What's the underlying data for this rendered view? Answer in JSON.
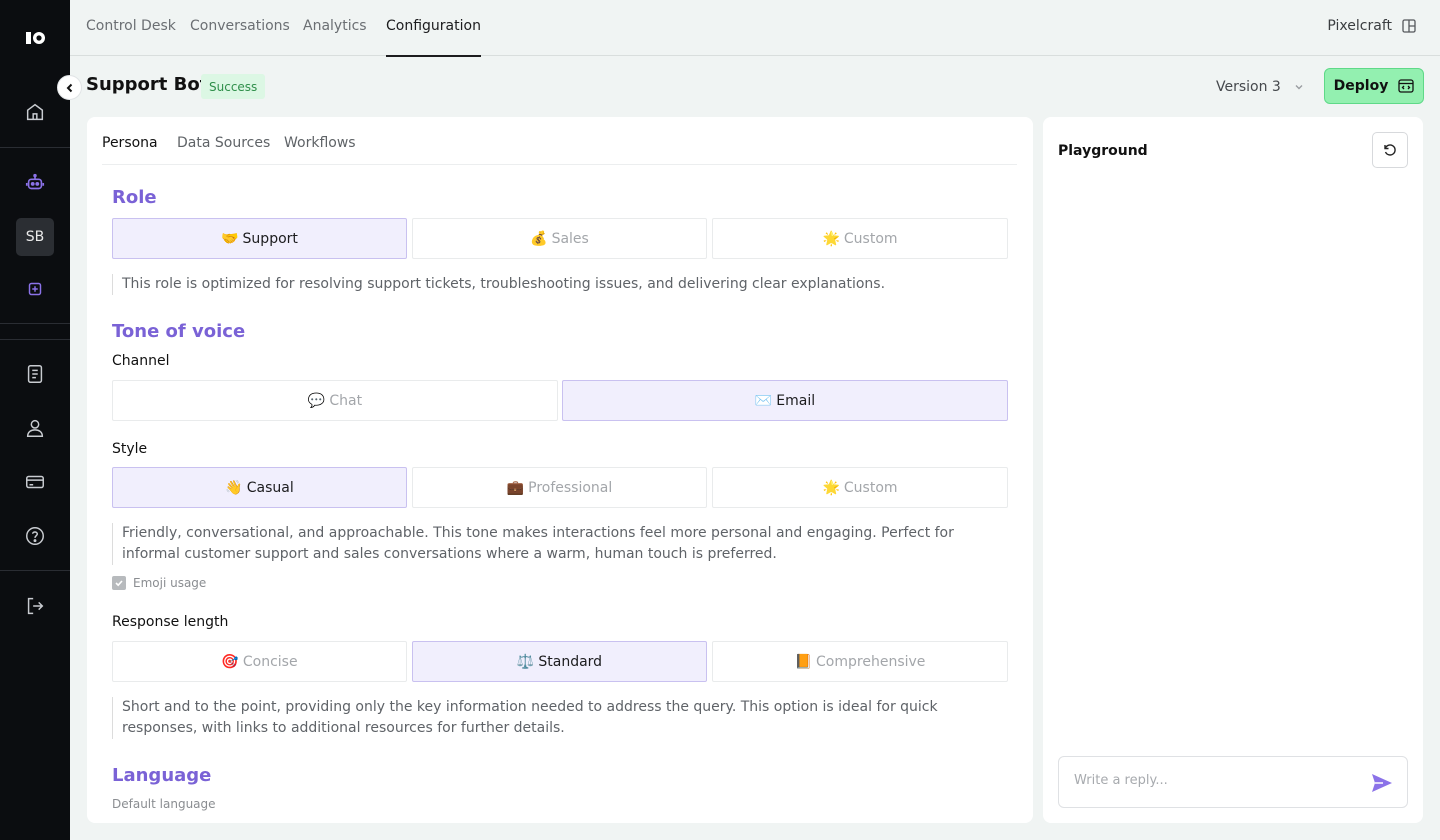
{
  "nav": {
    "tabs": [
      "Control Desk",
      "Conversations",
      "Analytics",
      "Configuration"
    ],
    "active_tab": "Configuration",
    "workspace": "Pixelcraft"
  },
  "sidebar": {
    "avatar_initials": "SB",
    "icons": [
      "logo-icon",
      "home-icon",
      "bot-icon",
      "add-bot-icon",
      "document-icon",
      "user-icon",
      "billing-card-icon",
      "help-icon",
      "logout-icon"
    ]
  },
  "header": {
    "title": "Support Bot",
    "status": "Success",
    "version": "Version 3",
    "deploy_label": "Deploy"
  },
  "subtabs": [
    "Persona",
    "Data Sources",
    "Workflows"
  ],
  "persona": {
    "role": {
      "title": "Role",
      "options": [
        {
          "emoji": "🤝",
          "label": "Support",
          "selected": true
        },
        {
          "emoji": "💰",
          "label": "Sales",
          "selected": false
        },
        {
          "emoji": "🌟",
          "label": "Custom",
          "selected": false
        }
      ],
      "description": "This role is optimized for resolving support tickets, troubleshooting issues, and delivering clear explanations."
    },
    "tone": {
      "title": "Tone of voice",
      "channel_label": "Channel",
      "channel_options": [
        {
          "emoji": "💬",
          "label": "Chat",
          "selected": false
        },
        {
          "emoji": "✉️",
          "label": "Email",
          "selected": true
        }
      ],
      "style_label": "Style",
      "style_options": [
        {
          "emoji": "👋",
          "label": "Casual",
          "selected": true
        },
        {
          "emoji": "💼",
          "label": "Professional",
          "selected": false
        },
        {
          "emoji": "🌟",
          "label": "Custom",
          "selected": false
        }
      ],
      "style_description": "Friendly, conversational, and approachable. This tone makes interactions feel more personal and engaging. Perfect for informal customer support and sales conversations where a warm, human touch is preferred.",
      "emoji_usage_label": "Emoji usage",
      "emoji_usage_checked": true,
      "length_label": "Response length",
      "length_options": [
        {
          "emoji": "🎯",
          "label": "Concise",
          "selected": false
        },
        {
          "emoji": "⚖️",
          "label": "Standard",
          "selected": true
        },
        {
          "emoji": "📙",
          "label": "Comprehensive",
          "selected": false
        }
      ],
      "length_description": "Short and to the point, providing only the key information needed to address the query. This option is ideal for quick responses, with links to additional resources for further details."
    },
    "language": {
      "title": "Language",
      "default_label": "Default language"
    }
  },
  "playground": {
    "title": "Playground",
    "reply_placeholder": "Write a reply..."
  },
  "colors": {
    "accent": "#7a62d6",
    "deploy_bg": "#93f0b0",
    "sidebar_bg": "#0b0d10",
    "selected_option_bg": "#f1effd",
    "send_icon": "#8b72e8"
  }
}
